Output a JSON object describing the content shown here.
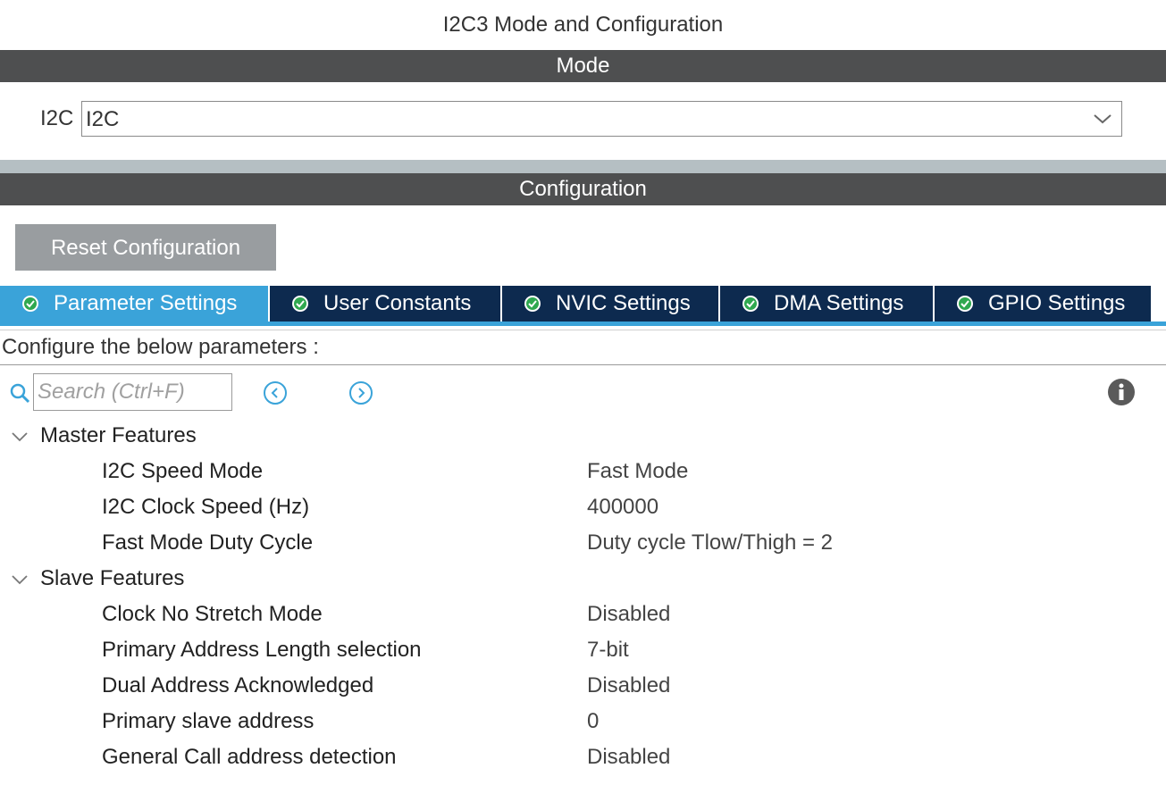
{
  "window": {
    "title": "I2C3 Mode and Configuration"
  },
  "mode_section": {
    "header": "Mode",
    "field_label": "I2C",
    "field_value": "I2C"
  },
  "config_section": {
    "header": "Configuration",
    "reset_label": "Reset Configuration"
  },
  "tabs": [
    {
      "label": "Parameter Settings",
      "active": true,
      "icon": "check-circle-icon"
    },
    {
      "label": "User Constants",
      "active": false,
      "icon": "check-circle-icon"
    },
    {
      "label": "NVIC Settings",
      "active": false,
      "icon": "check-circle-icon"
    },
    {
      "label": "DMA Settings",
      "active": false,
      "icon": "check-circle-icon"
    },
    {
      "label": "GPIO Settings",
      "active": false,
      "icon": "check-circle-icon"
    }
  ],
  "info_bar": {
    "text": "Configure the below parameters :"
  },
  "search": {
    "placeholder": "Search (Ctrl+F)"
  },
  "groups": [
    {
      "label": "Master Features",
      "params": [
        {
          "name": "I2C Speed Mode",
          "value": "Fast Mode"
        },
        {
          "name": "I2C Clock Speed (Hz)",
          "value": "400000"
        },
        {
          "name": "Fast Mode Duty Cycle",
          "value": "Duty cycle Tlow/Thigh = 2"
        }
      ]
    },
    {
      "label": "Slave Features",
      "params": [
        {
          "name": "Clock No Stretch Mode",
          "value": "Disabled"
        },
        {
          "name": "Primary Address Length selection",
          "value": "7-bit"
        },
        {
          "name": "Dual Address Acknowledged",
          "value": "Disabled"
        },
        {
          "name": "Primary slave address",
          "value": "0"
        },
        {
          "name": "General Call address detection",
          "value": "Disabled"
        }
      ]
    }
  ],
  "colors": {
    "band": "#4e4f50",
    "tab_active": "#3aa3d9",
    "tab_inactive": "#0d2a4f",
    "check_green": "#2fa84f",
    "reset_button": "#999da0"
  }
}
